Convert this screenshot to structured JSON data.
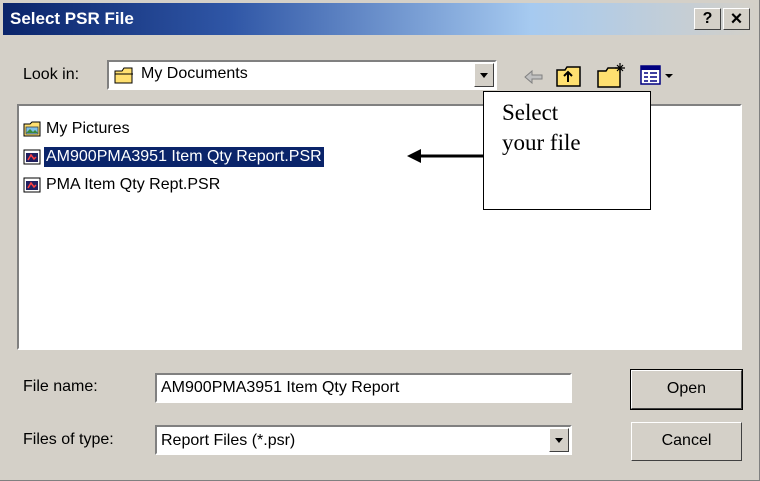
{
  "title": "Select PSR File",
  "title_buttons": {
    "help": "?",
    "close": "×"
  },
  "look_in": {
    "label": "Look in:",
    "value": "My Documents"
  },
  "files": [
    {
      "name": "My Pictures",
      "icon": "folder-pictures-icon"
    },
    {
      "name": "AM900PMA3951 Item Qty Report.PSR",
      "icon": "psr-file-icon",
      "selected": true
    },
    {
      "name": "PMA Item Qty Rept.PSR",
      "icon": "psr-file-icon"
    }
  ],
  "callout": {
    "line1": "Select",
    "line2": "your file"
  },
  "file_name": {
    "label": "File name:",
    "value": "AM900PMA3951 Item Qty Report"
  },
  "file_type": {
    "label": "Files of type:",
    "value": "Report Files (*.psr)"
  },
  "buttons": {
    "open": "Open",
    "cancel": "Cancel"
  },
  "colors": {
    "title_start": "#0a246a",
    "selection": "#0a246a",
    "face": "#d4d0c8"
  }
}
